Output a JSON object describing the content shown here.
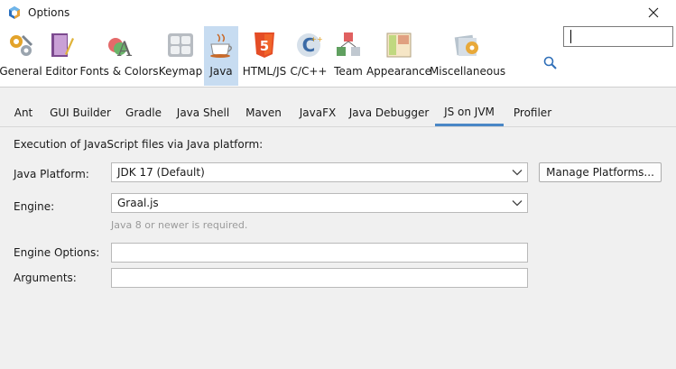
{
  "window": {
    "title": "Options"
  },
  "categories": [
    {
      "id": "general",
      "label": "General",
      "icon": "gears-icon"
    },
    {
      "id": "editor",
      "label": "Editor",
      "icon": "notebook-pen-icon"
    },
    {
      "id": "fonts",
      "label": "Fonts & Colors",
      "icon": "fonts-colors-icon"
    },
    {
      "id": "keymap",
      "label": "Keymap",
      "icon": "keyboard-keys-icon"
    },
    {
      "id": "java",
      "label": "Java",
      "icon": "coffee-cup-icon",
      "selected": true
    },
    {
      "id": "htmljs",
      "label": "HTML/JS",
      "icon": "html5-shield-icon"
    },
    {
      "id": "cpp",
      "label": "C/C++",
      "icon": "cpp-logo-icon"
    },
    {
      "id": "team",
      "label": "Team",
      "icon": "cubes-icon"
    },
    {
      "id": "appearance",
      "label": "Appearance",
      "icon": "window-layout-icon"
    },
    {
      "id": "misc",
      "label": "Miscellaneous",
      "icon": "gear-folder-icon"
    }
  ],
  "search": {
    "value": ""
  },
  "tabs": [
    {
      "label": "Ant"
    },
    {
      "label": "GUI Builder"
    },
    {
      "label": "Gradle"
    },
    {
      "label": "Java Shell"
    },
    {
      "label": "Maven"
    },
    {
      "label": "JavaFX"
    },
    {
      "label": "Java Debugger"
    },
    {
      "label": "JS on JVM",
      "active": true
    },
    {
      "label": "Profiler"
    }
  ],
  "panel": {
    "heading": "Execution of JavaScript files via Java platform:",
    "java_platform": {
      "label": "Java Platform:",
      "value": "JDK 17 (Default)",
      "manage_button": "Manage Platforms..."
    },
    "engine": {
      "label": "Engine:",
      "value": "Graal.js",
      "hint": "Java 8 or newer is required."
    },
    "engine_options": {
      "label": "Engine Options:",
      "value": ""
    },
    "arguments": {
      "label": "Arguments:",
      "value": ""
    }
  },
  "colors": {
    "selected_category_bg": "#c7dcf1",
    "active_tab_underline": "#4a87c6",
    "hint_text": "#9a9a9a"
  }
}
